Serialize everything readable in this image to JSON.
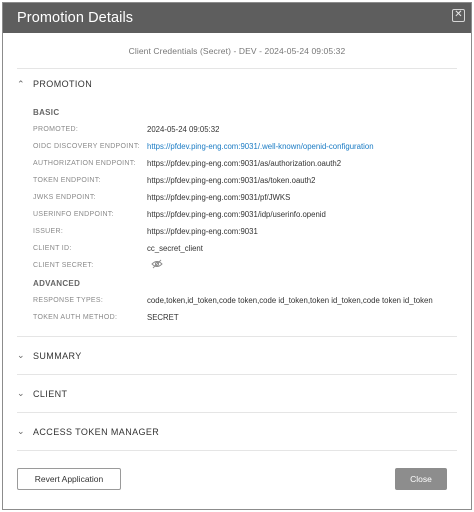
{
  "dialog": {
    "title": "Promotion Details",
    "close_icon": "close-icon"
  },
  "subtitle": "Client Credentials (Secret) - DEV - 2024-05-24 09:05:32",
  "sections": {
    "promotion": "PROMOTION",
    "summary": "SUMMARY",
    "client": "CLIENT",
    "atm": "ACCESS TOKEN MANAGER"
  },
  "basic": {
    "title": "BASIC",
    "fields": [
      {
        "label": "PROMOTED:",
        "value": "2024-05-24 09:05:32"
      },
      {
        "label": "OIDC DISCOVERY ENDPOINT:",
        "value": "https://pfdev.ping-eng.com:9031/.well-known/openid-configuration"
      },
      {
        "label": "AUTHORIZATION ENDPOINT:",
        "value": "https://pfdev.ping-eng.com:9031/as/authorization.oauth2"
      },
      {
        "label": "TOKEN ENDPOINT:",
        "value": "https://pfdev.ping-eng.com:9031/as/token.oauth2"
      },
      {
        "label": "JWKS ENDPOINT:",
        "value": "https://pfdev.ping-eng.com:9031/pf/JWKS"
      },
      {
        "label": "USERINFO ENDPOINT:",
        "value": "https://pfdev.ping-eng.com:9031/idp/userinfo.openid"
      },
      {
        "label": "ISSUER:",
        "value": "https://pfdev.ping-eng.com:9031"
      },
      {
        "label": "CLIENT ID:",
        "value": "cc_secret_client"
      },
      {
        "label": "CLIENT SECRET:",
        "icon": "eye-slash-icon"
      }
    ]
  },
  "advanced": {
    "title": "ADVANCED",
    "fields": [
      {
        "label": "RESPONSE TYPES:",
        "value": "code,token,id_token,code token,code id_token,token id_token,code token id_token"
      },
      {
        "label": "TOKEN AUTH METHOD:",
        "value": "SECRET"
      }
    ]
  },
  "buttons": {
    "revert": "Revert Application",
    "close": "Close"
  },
  "colors": {
    "titlebar": "#5e5e5e",
    "link": "#1a7bc4",
    "close_button": "#8d8d8d"
  }
}
